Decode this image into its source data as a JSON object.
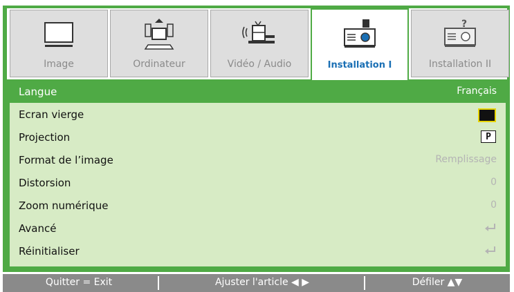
{
  "tabs": [
    {
      "label": "Image",
      "icon": "monitor-icon",
      "active": false
    },
    {
      "label": "Ordinateur",
      "icon": "computer-icon",
      "active": false
    },
    {
      "label": "Vidéo / Audio",
      "icon": "video-audio-icon",
      "active": false
    },
    {
      "label": "Installation I",
      "icon": "projector-icon",
      "active": true
    },
    {
      "label": "Installation II",
      "icon": "projector-help-icon",
      "active": false
    }
  ],
  "menu": [
    {
      "name": "Langue",
      "value": "Français",
      "selected": true
    },
    {
      "name": "Ecran vierge",
      "value_type": "blank-screen-swatch"
    },
    {
      "name": "Projection",
      "value": "P",
      "value_type": "projection-mode-icon"
    },
    {
      "name": "Format de l’image",
      "value": "Remplissage"
    },
    {
      "name": "Distorsion",
      "value": "0"
    },
    {
      "name": "Zoom numérique",
      "value": "0"
    },
    {
      "name": "Avancé",
      "value_type": "enter-arrow-icon"
    },
    {
      "name": "Réinitialiser",
      "value_type": "enter-arrow-icon"
    }
  ],
  "footer": {
    "exit": "Quitter = Exit",
    "adjust": "Ajuster l'article ◀ ▶",
    "scroll": "Défiler ▲▼"
  },
  "colors": {
    "accent": "#4faa45",
    "menu_bg": "#d7ebc5",
    "active_tab_text": "#1a6fb4",
    "footer_bg": "#8a8a8a",
    "blank_swatch_border": "#e8d400"
  }
}
